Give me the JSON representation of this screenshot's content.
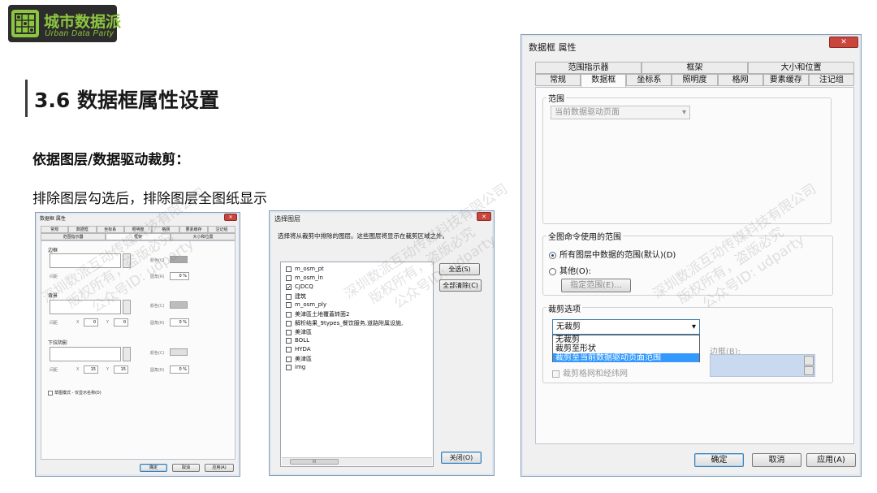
{
  "logo": {
    "name": "城市数据派",
    "tagline": "Urban Data Party"
  },
  "slide": {
    "title": "3.6 数据框属性设置",
    "subtitle": "依据图层/数据驱动裁剪：",
    "description": "排除图层勾选后，排除图层全图纸显示"
  },
  "window_small": {
    "title": "数据框 属性",
    "tabs_row1": [
      "常规",
      "数据框",
      "坐标系",
      "照明度",
      "格网",
      "要素缓存",
      "注记组"
    ],
    "tabs_row2": [
      "范围指示器",
      "框架",
      "大小和位置"
    ],
    "active_tab": "框架",
    "groups": {
      "border": "边框",
      "background": "背景",
      "shadow": "下拉阴影"
    },
    "fields": {
      "gap": "间距",
      "rounding": "圆角(R)",
      "color": "颜色(C)"
    },
    "units": {
      "x": "X",
      "y": "Y"
    },
    "values": {
      "zero": "0",
      "fifteen": "15",
      "zero_percent": "0 %"
    },
    "draft_mode": "草图模式 - 仅显示名称(D)",
    "buttons": {
      "ok": "确定",
      "cancel": "取消",
      "apply": "应用(A)"
    }
  },
  "window_select": {
    "title": "选择图层",
    "prompt": "选择将从裁剪中排除的图层。这些图层将显示在裁剪区域之外。",
    "layers": [
      {
        "name": "m_osm_pt",
        "checked": false
      },
      {
        "name": "m_osm_ln",
        "checked": false
      },
      {
        "name": "CJDCQ",
        "checked": true
      },
      {
        "name": "建筑",
        "checked": false
      },
      {
        "name": "m_osm_ply",
        "checked": false
      },
      {
        "name": "美津區土地覆蓋转面2",
        "checked": false
      },
      {
        "name": "解析结果_9types_餐饮服务,道路附属设施,",
        "checked": false
      },
      {
        "name": "美津區",
        "checked": false
      },
      {
        "name": "BOLL",
        "checked": false
      },
      {
        "name": "HYDA",
        "checked": false
      },
      {
        "name": "美津區",
        "checked": false
      },
      {
        "name": "img",
        "checked": false
      }
    ],
    "check_mark": "✓",
    "scroll_marker": "III",
    "buttons": {
      "select_all": "全选(S)",
      "clear_all": "全部清除(C)",
      "close": "关闭(O)"
    }
  },
  "window_large": {
    "title": "数据框 属性",
    "tabs_row1": [
      "范围指示器",
      "框架",
      "大小和位置"
    ],
    "tabs_row2": [
      "常规",
      "数据框",
      "坐标系",
      "照明度",
      "格网",
      "要素缓存",
      "注记组"
    ],
    "active_tab": "数据框",
    "extent": {
      "legend": "范围",
      "value": "当前数据驱动页面",
      "arrow": "▾"
    },
    "full_extent": {
      "legend": "全图命令使用的范围",
      "option_all": "所有图层中数据的范围(默认)(D)",
      "option_other": "其他(O):",
      "specify_button": "指定范围(E)..."
    },
    "clip": {
      "legend": "裁剪选项",
      "selected": "无裁剪",
      "arrow": "▾",
      "options": [
        "无裁剪",
        "裁剪至形状",
        "裁剪至当前数据驱动页面范围"
      ],
      "highlighted_index": 2,
      "border_label": "边框(B):",
      "clip_grids": "裁剪格网和经纬网"
    },
    "buttons": {
      "ok": "确定",
      "cancel": "取消",
      "apply": "应用(A)"
    }
  },
  "watermark": {
    "line1": "深圳数派互动传媒科技有限公司",
    "line2": "版权所有，盗版必究",
    "line3": "公众号ID: udparty"
  },
  "colors": {
    "logo_green": "#8cc63f",
    "logo_bg": "#2c2c2c",
    "highlight": "#3399ff",
    "close_red": "#c9463d"
  }
}
